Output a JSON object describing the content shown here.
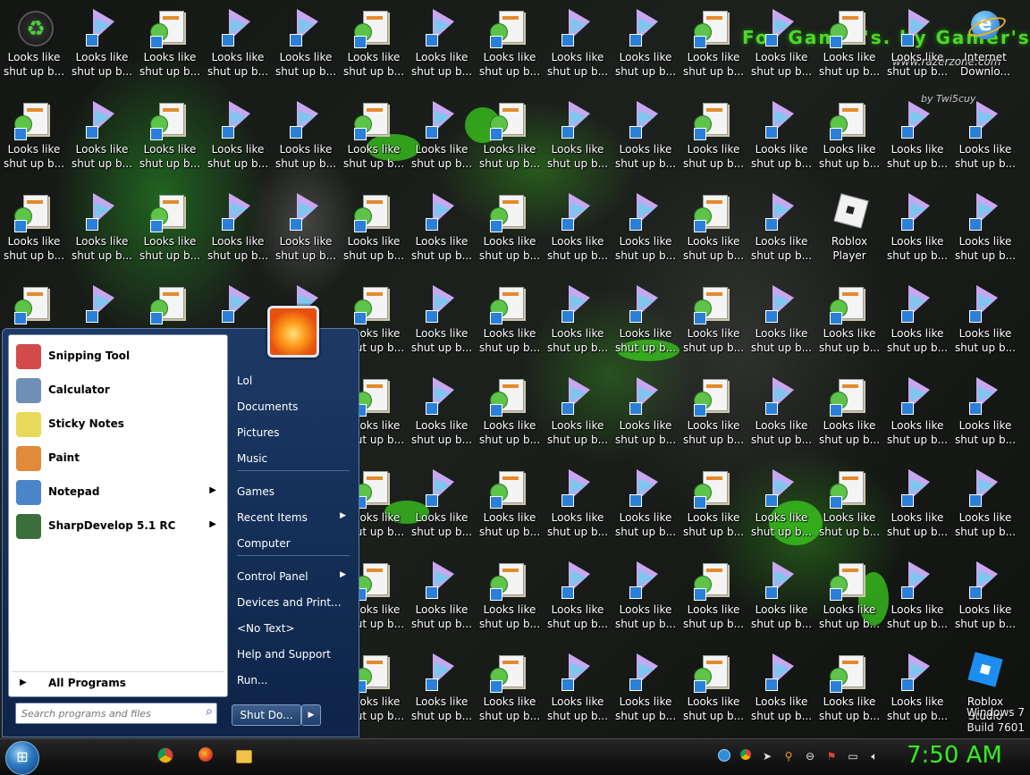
{
  "wallpaper": {
    "banner": "For Gamer's. by Gamer's.",
    "site": "www.razerzone.com",
    "tag": "by Twi5cuy"
  },
  "desktop": {
    "common_label": "Looks like\nshut up b...",
    "special": [
      {
        "col": 0,
        "row": 0,
        "label": "Looks like\nshut up b...",
        "icon": "recycle-bin-icon"
      },
      {
        "col": 14,
        "row": 0,
        "label": "Internet\nDownlo...",
        "icon": "internet-explorer-icon"
      },
      {
        "col": 12,
        "row": 2,
        "label": "Roblox\nPlayer",
        "icon": "roblox-icon"
      },
      {
        "col": 14,
        "row": 7,
        "label": "Roblox\nStudio",
        "icon": "roblox-studio-icon"
      }
    ]
  },
  "watermark": {
    "line1": "Windows 7",
    "line2": "Build 7601"
  },
  "start_menu": {
    "programs": [
      {
        "label": "Snipping Tool",
        "icon": "snipping-tool-icon",
        "submenu": false,
        "color": "#d34a4a"
      },
      {
        "label": "Calculator",
        "icon": "calculator-icon",
        "submenu": false,
        "color": "#6f8fb5"
      },
      {
        "label": "Sticky Notes",
        "icon": "sticky-notes-icon",
        "submenu": false,
        "color": "#e8d95a"
      },
      {
        "label": "Paint",
        "icon": "paint-icon",
        "submenu": false,
        "color": "#e08a3a"
      },
      {
        "label": "Notepad",
        "icon": "notepad-icon",
        "submenu": true,
        "color": "#4a84c9"
      },
      {
        "label": "SharpDevelop 5.1 RC",
        "icon": "sharpdevelop-icon",
        "submenu": true,
        "color": "#3a6e3a"
      }
    ],
    "submenu_arrow": "▶",
    "all_programs": "All Programs",
    "search_placeholder": "Search programs and files",
    "places": [
      {
        "label": "Lol",
        "submenu": false
      },
      {
        "label": "Documents",
        "submenu": false
      },
      {
        "label": "Pictures",
        "submenu": false
      },
      {
        "label": "Music",
        "submenu": false
      },
      {
        "label": "Games",
        "submenu": false
      },
      {
        "label": "Recent Items",
        "submenu": true
      },
      {
        "label": "Computer",
        "submenu": false
      },
      {
        "label": "Control Panel",
        "submenu": true
      },
      {
        "label": "Devices and Print...",
        "submenu": false
      },
      {
        "label": "<No Text>",
        "submenu": false
      },
      {
        "label": "Help and Support",
        "submenu": false
      },
      {
        "label": "Run...",
        "submenu": false
      }
    ],
    "shutdown_label": "Shut Do..."
  },
  "taskbar": {
    "pinned": [
      "chrome-icon",
      "firefox-icon",
      "explorer-folder-icon"
    ],
    "tray": [
      "network-globe-icon",
      "chrome-tray-icon",
      "cursor-icon",
      "search-tray-icon",
      "minus-circle-icon",
      "flag-icon",
      "display-icon",
      "volume-icon"
    ],
    "clock": "7:50 AM"
  }
}
